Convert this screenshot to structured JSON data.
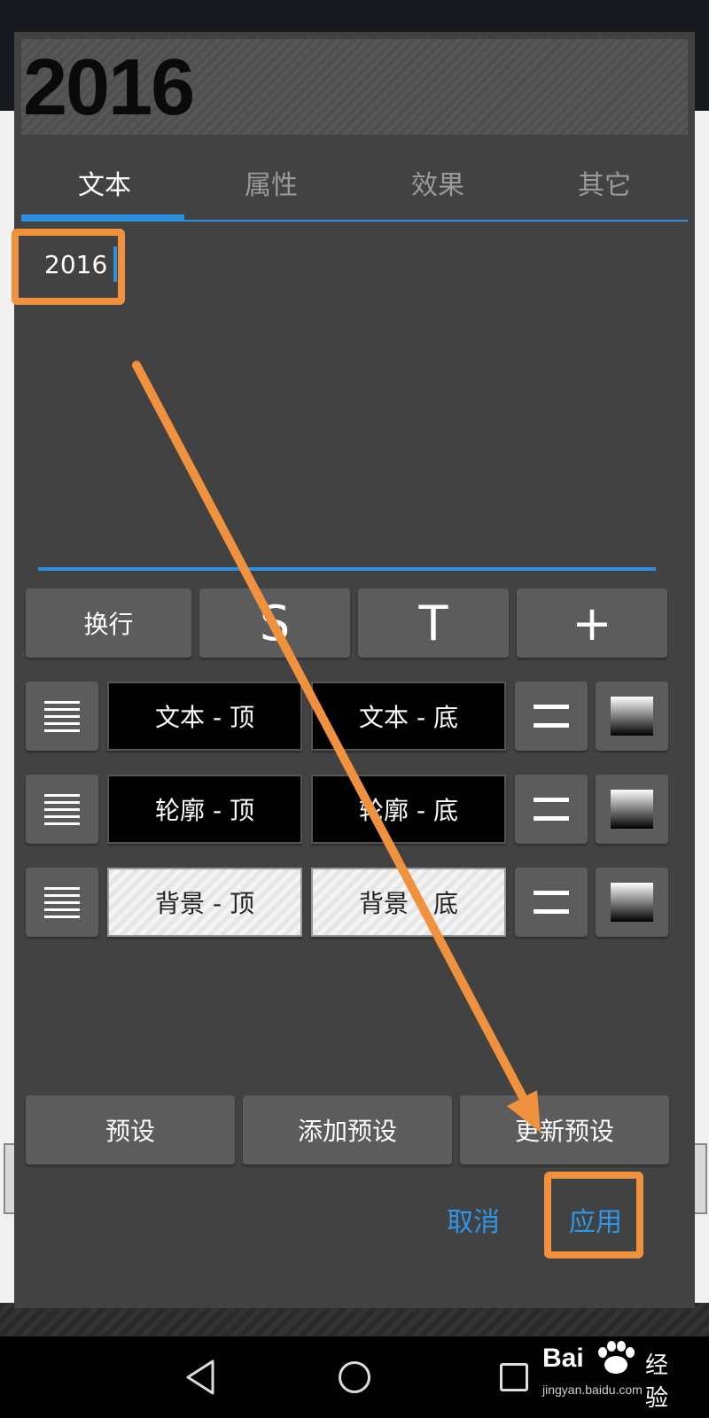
{
  "preview": {
    "text": "2016"
  },
  "tabs": [
    {
      "label": "文本",
      "active": true
    },
    {
      "label": "属性",
      "active": false
    },
    {
      "label": "效果",
      "active": false
    },
    {
      "label": "其它",
      "active": false
    }
  ],
  "editor": {
    "value": "2016"
  },
  "toolbar": {
    "wrap_label": "换行",
    "s_label": "S",
    "t_label": "T",
    "plus_label": "+"
  },
  "color_rows": [
    {
      "top_label": "文本 - 顶",
      "bottom_label": "文本 - 底",
      "style": "black"
    },
    {
      "top_label": "轮廓 - 顶",
      "bottom_label": "轮廓 - 底",
      "style": "black"
    },
    {
      "top_label": "背景 - 顶",
      "bottom_label": "背景 - 底",
      "style": "pattern"
    }
  ],
  "presets": {
    "preset_label": "预设",
    "add_label": "添加预设",
    "update_label": "更新预设"
  },
  "actions": {
    "cancel_label": "取消",
    "apply_label": "应用"
  },
  "colors": {
    "accent": "#2e8fe0",
    "annotation": "#f0913e",
    "dialog_bg": "#424242",
    "button_bg": "#5c5c5c"
  },
  "watermark": {
    "brand": "Bai",
    "sub": "经验",
    "url": "jingyan.baidu.com"
  }
}
